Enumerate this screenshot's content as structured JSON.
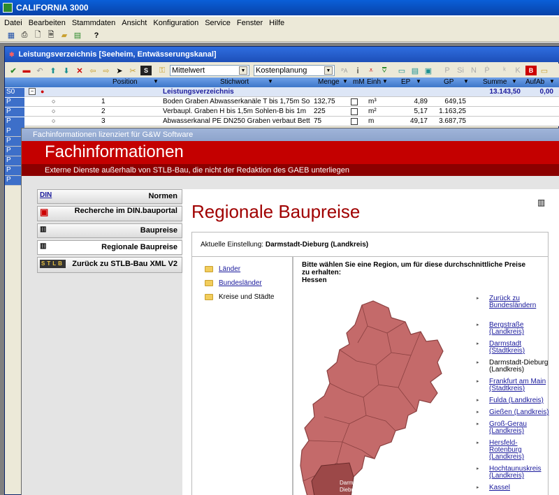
{
  "app": {
    "title": "CALIFORNIA 3000"
  },
  "menu": [
    "Datei",
    "Bearbeiten",
    "Stammdaten",
    "Ansicht",
    "Konfiguration",
    "Service",
    "Fenster",
    "Hilfe"
  ],
  "lv": {
    "title": "Leistungsverzeichnis [Seeheim, Entwässerungskanal]",
    "combo1": "Mittelwert",
    "combo2": "Kostenplanung",
    "columns": {
      "position": "Position",
      "stichwort": "Stichwort",
      "menge": "Menge",
      "mm": "mM",
      "einh": "Einh",
      "ep": "EP",
      "gp": "GP",
      "summe": "Summe",
      "aufab": "AufAb"
    },
    "header_row": {
      "type": "S0",
      "stichwort": "Leistungsverzeichnis",
      "summe": "13.143,50",
      "aufab": "0,00"
    },
    "rows": [
      {
        "type": "P",
        "pos": "1",
        "text": "Boden Graben Abwasserkanäle T bis 1,75m So",
        "menge": "132,75",
        "einh": "m³",
        "ep": "4,89",
        "gp": "649,15"
      },
      {
        "type": "P",
        "pos": "2",
        "text": "Verbaupl. Graben H bis 1,5m Sohlen-B bis 1m",
        "menge": "225",
        "einh": "m²",
        "ep": "5,17",
        "gp": "1.163,25"
      },
      {
        "type": "P",
        "pos": "3",
        "text": "Abwasserkanal PE DN250 Graben verbaut Bett",
        "menge": "75",
        "einh": "m",
        "ep": "49,17",
        "gp": "3.687,75"
      }
    ],
    "extra_types": [
      "P",
      "P",
      "P",
      "P",
      "P",
      "P"
    ]
  },
  "fi": {
    "window_title": "Fachinformationen lizenziert für G&W Software",
    "banner_title": "Fachinformationen",
    "banner_subtitle": "Externe Dienste außerhalb von STLB-Bau, die nicht der Redaktion des GAEB unterliegen",
    "nav": [
      {
        "icon": "DIN",
        "label": "Normen"
      },
      {
        "icon": "▣",
        "label": "Recherche im DIN.bauportal"
      },
      {
        "icon": "▥",
        "label": "Baupreise"
      },
      {
        "icon": "▥",
        "label": "Regionale Baupreise"
      },
      {
        "icon": "STLB",
        "label": "Zurück zu STLB-Bau XML V2"
      }
    ],
    "page_title": "Regionale Baupreise",
    "setting_label": "Aktuelle Einstellung:",
    "setting_value": "Darmstadt-Dieburg (Landkreis)",
    "tree": [
      {
        "label": "Länder",
        "link": true
      },
      {
        "label": "Bundesländer",
        "link": true
      },
      {
        "label": "Kreise und Städte",
        "link": false
      }
    ],
    "intro": "Bitte wählen Sie eine Region, um für diese durchschnittliche Preise zu erhalten:",
    "region": "Hessen",
    "map_label": "Darmstadt-Dieburg",
    "regions": [
      {
        "label": "Zurück zu Bundesländern",
        "link": true
      },
      {
        "label": "Bergstraße (Landkreis)",
        "link": true
      },
      {
        "label": "Darmstadt (Stadtkreis)",
        "link": true
      },
      {
        "label": "Darmstadt-Dieburg (Landkreis)",
        "link": false
      },
      {
        "label": "Frankfurt am Main (Stadtkreis)",
        "link": true
      },
      {
        "label": "Fulda (Landkreis)",
        "link": true
      },
      {
        "label": "Gießen (Landkreis)",
        "link": true
      },
      {
        "label": "Groß-Gerau (Landkreis)",
        "link": true
      },
      {
        "label": "Hersfeld-Rotenburg (Landkreis)",
        "link": true
      },
      {
        "label": "Hochtaunuskreis (Landkreis)",
        "link": true
      },
      {
        "label": "Kassel",
        "link": true
      }
    ]
  }
}
